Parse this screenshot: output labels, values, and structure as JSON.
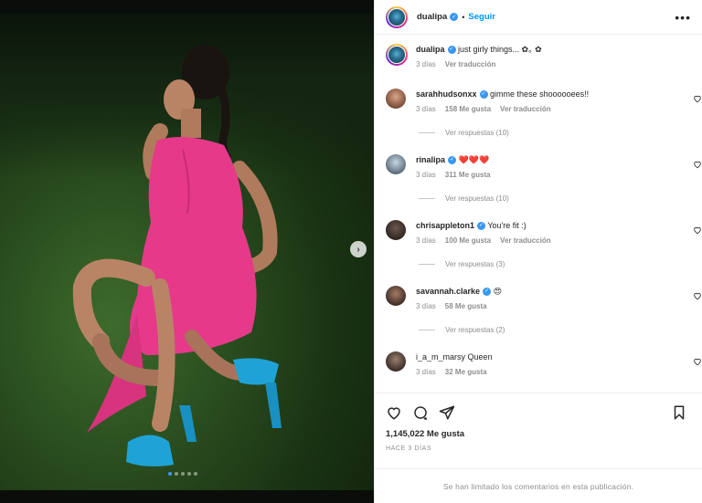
{
  "post": {
    "author": "dualipa",
    "verified": true,
    "follow_label": "Seguir",
    "separator": "•",
    "more_label": "•••",
    "caption": "just girly things... ✿｡ ✿",
    "caption_time": "3 días",
    "translate_label": "Ver traducción",
    "carousel_count": 5,
    "carousel_index": 1,
    "next_glyph": "›"
  },
  "comments": [
    {
      "user": "sarahhudsonxx",
      "verified": true,
      "text": "gimme these shoooooees!!",
      "time": "3 días",
      "likes": "158 Me gusta",
      "translate": "Ver traducción",
      "replies": "Ver respuestas (10)"
    },
    {
      "user": "rinalipa",
      "verified": true,
      "text": "❤️❤️❤️",
      "time": "3 días",
      "likes": "311 Me gusta",
      "translate": "",
      "replies": "Ver respuestas (10)"
    },
    {
      "user": "chrisappleton1",
      "verified": true,
      "text": "You're fit :)",
      "time": "3 días",
      "likes": "100 Me gusta",
      "translate": "Ver traducción",
      "replies": "Ver respuestas (3)"
    },
    {
      "user": "savannah.clarke",
      "verified": true,
      "text": "😍",
      "time": "3 días",
      "likes": "58 Me gusta",
      "translate": "",
      "replies": "Ver respuestas (2)"
    },
    {
      "user": "i_a_m_marsy",
      "verified": false,
      "text": "Queen",
      "time": "3 días",
      "likes": "32 Me gusta",
      "translate": "",
      "replies": ""
    }
  ],
  "footer": {
    "likes": "1,145,022 Me gusta",
    "time_ago": "HACE 3 DÍAS",
    "limited_notice": "Se han limitado los comentarios en esta publicación."
  },
  "colors": {
    "accent": "#0095f6",
    "verified": "#3897f0",
    "muted": "#8e8e8e",
    "text": "#262626",
    "dress": "#e6398a",
    "shoes": "#1fa3d6"
  }
}
